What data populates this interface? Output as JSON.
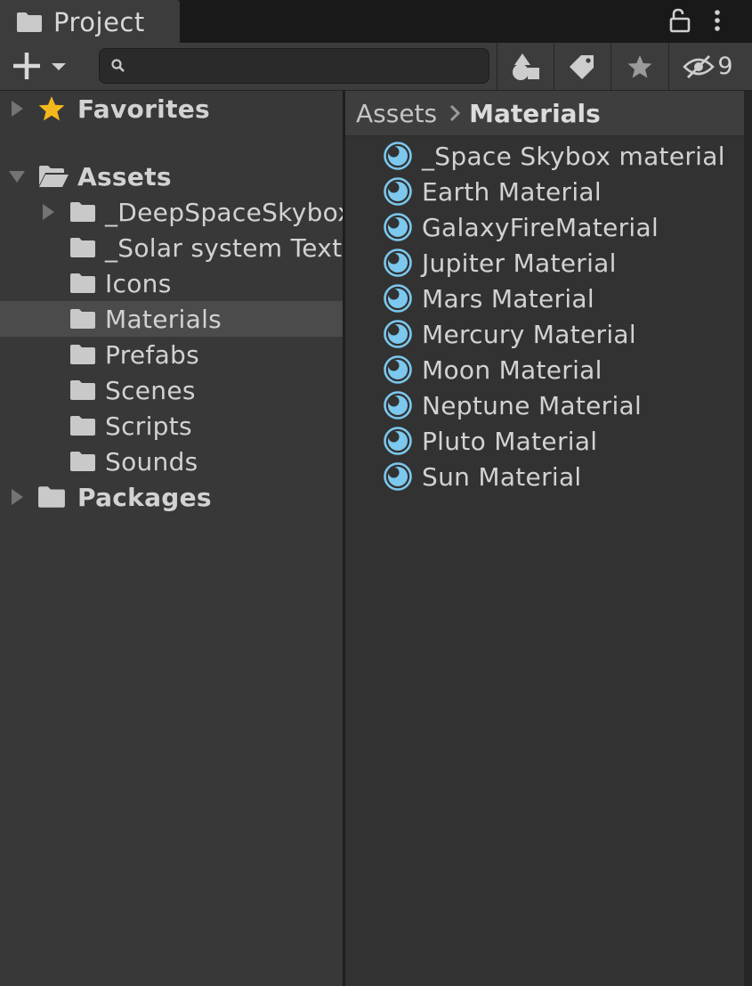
{
  "tab": {
    "title": "Project",
    "icon": "folder-icon"
  },
  "window_controls": {
    "lock_icon": "lock-icon",
    "menu_icon": "kebab-menu-icon"
  },
  "toolbar": {
    "create_icon": "plus-icon",
    "search": {
      "value": "",
      "placeholder": ""
    },
    "filter_buttons": [
      "search-by-type-icon",
      "search-by-label-icon",
      "favorite-star-icon"
    ],
    "hidden_packages_count": "9"
  },
  "tree": {
    "favorites": "Favorites",
    "assets": "Assets",
    "packages": "Packages",
    "folders": [
      "_DeepSpaceSkybox",
      "_Solar system Textures",
      "Icons",
      "Materials",
      "Prefabs",
      "Scenes",
      "Scripts",
      "Sounds"
    ],
    "selected": "Materials"
  },
  "breadcrumb": {
    "root": "Assets",
    "current": "Materials"
  },
  "materials": [
    "_Space Skybox material",
    "Earth Material",
    "GalaxyFireMaterial",
    "Jupiter Material",
    "Mars Material",
    "Mercury Material",
    "Moon Material",
    "Neptune Material",
    "Pluto Material",
    "Sun Material"
  ],
  "colors": {
    "material_icon": "#7cc8ee",
    "favorites_star": "#f5b81c",
    "selection": "#4b4b4b"
  }
}
